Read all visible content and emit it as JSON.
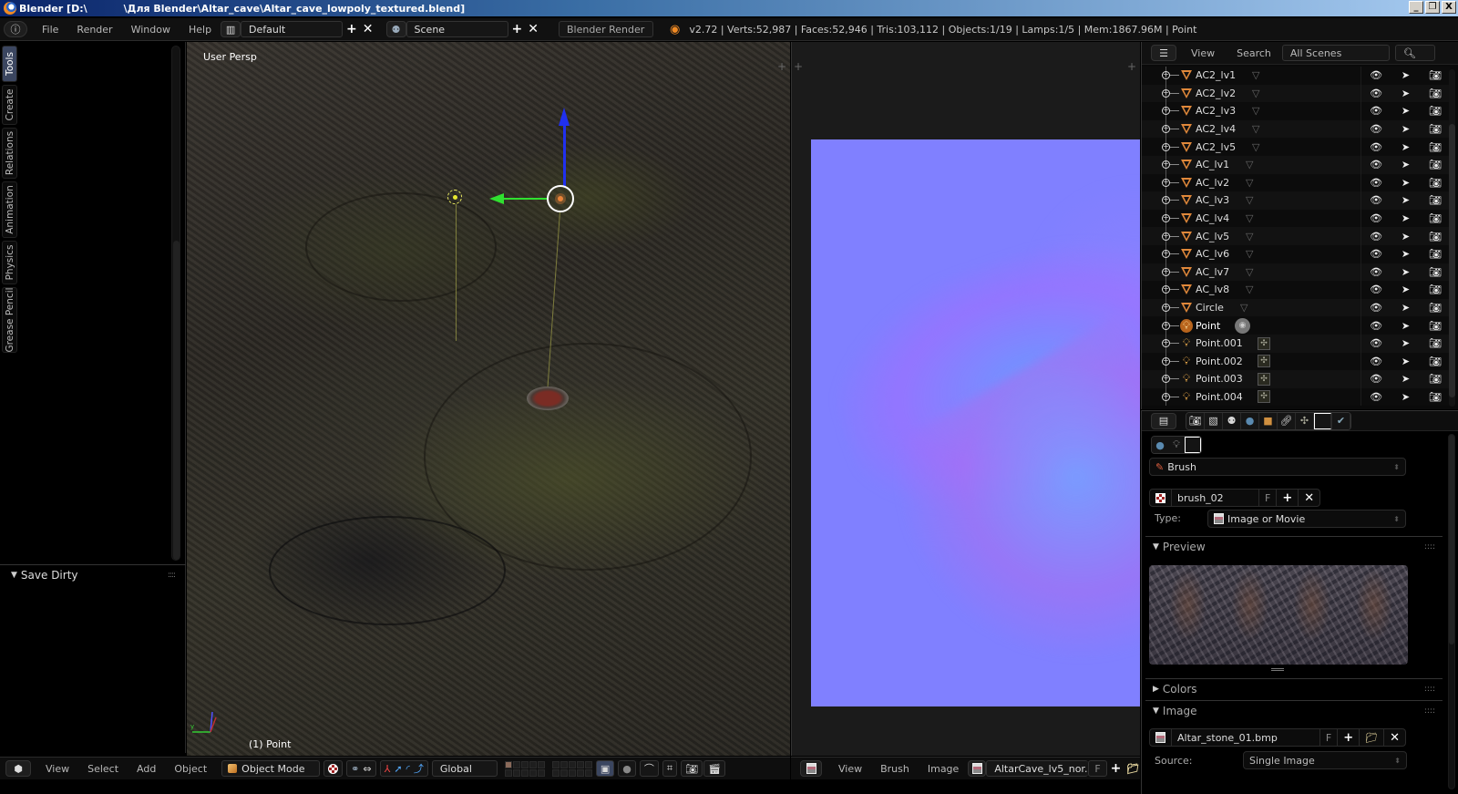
{
  "window": {
    "title_left": "Blender [D:\\",
    "title_path": "\\Для Blender\\Altar_cave\\Altar_cave_lowpoly_textured.blend]",
    "controls": [
      "_",
      "❐",
      "X"
    ]
  },
  "info_header": {
    "menus": [
      "File",
      "Render",
      "Window",
      "Help"
    ],
    "screen_layout": "Default",
    "scene": "Scene",
    "render_engine": "Blender Render",
    "stats": "v2.72 | Verts:52,987 | Faces:52,946 | Tris:103,112 | Objects:1/19 | Lamps:1/5 | Mem:1867.96M | Point"
  },
  "toolshelf": {
    "tabs": [
      {
        "label": "Tools",
        "active": true
      },
      {
        "label": "Create",
        "active": false
      },
      {
        "label": "Relations",
        "active": false
      },
      {
        "label": "Animation",
        "active": false
      },
      {
        "label": "Physics",
        "active": false
      },
      {
        "label": "Grease Pencil",
        "active": false
      }
    ],
    "panel": "Save Dirty"
  },
  "viewport": {
    "view_label": "User Persp",
    "active_object": "(1) Point",
    "header": {
      "menus": [
        "View",
        "Select",
        "Add",
        "Object"
      ],
      "mode": "Object Mode",
      "orientation": "Global"
    }
  },
  "image_editor": {
    "header": {
      "menus": [
        "View",
        "Brush",
        "Image"
      ],
      "image_name": "AltarCave_lv5_nor...",
      "fake_user": "F"
    },
    "canvas_color": "#8080ff"
  },
  "outliner": {
    "header": {
      "menus": [
        "View",
        "Search"
      ],
      "display_mode": "All Scenes"
    },
    "items": [
      {
        "name": "AC2_lv1",
        "type": "mesh"
      },
      {
        "name": "AC2_lv2",
        "type": "mesh"
      },
      {
        "name": "AC2_lv3",
        "type": "mesh"
      },
      {
        "name": "AC2_lv4",
        "type": "mesh"
      },
      {
        "name": "AC2_lv5",
        "type": "mesh"
      },
      {
        "name": "AC_lv1",
        "type": "mesh"
      },
      {
        "name": "AC_lv2",
        "type": "mesh"
      },
      {
        "name": "AC_lv3",
        "type": "mesh"
      },
      {
        "name": "AC_lv4",
        "type": "mesh"
      },
      {
        "name": "AC_lv5",
        "type": "mesh"
      },
      {
        "name": "AC_lv6",
        "type": "mesh"
      },
      {
        "name": "AC_lv7",
        "type": "mesh"
      },
      {
        "name": "AC_lv8",
        "type": "mesh"
      },
      {
        "name": "Circle",
        "type": "mesh"
      },
      {
        "name": "Point",
        "type": "lamp",
        "active": true
      },
      {
        "name": "Point.001",
        "type": "lamp"
      },
      {
        "name": "Point.002",
        "type": "lamp"
      },
      {
        "name": "Point.003",
        "type": "lamp"
      },
      {
        "name": "Point.004",
        "type": "lamp"
      }
    ]
  },
  "properties": {
    "context": "Texture",
    "texture_context": "Brush",
    "texture_context_label": "Brush",
    "texture_name": "brush_02",
    "fake_user": "F",
    "type_label": "Type:",
    "type_value": "Image or Movie",
    "panels": {
      "preview": "Preview",
      "colors": "Colors",
      "image": "Image"
    },
    "image_name": "Altar_stone_01.bmp",
    "source_label": "Source:",
    "source_value": "Single Image"
  }
}
